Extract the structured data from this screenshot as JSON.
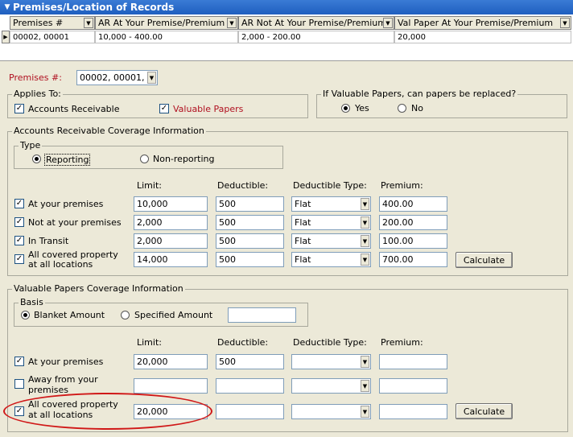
{
  "title": "Premises/Location of Records",
  "grid": {
    "columns": [
      "Premises #",
      "AR At Your Premise/Premium",
      "AR Not At Your Premise/Premium",
      "Val Paper At Your Premise/Premium"
    ],
    "rows": [
      [
        "00002, 00001",
        "10,000 - 400.00",
        "2,000 - 200.00",
        "20,000"
      ]
    ]
  },
  "premises": {
    "label": "Premises #:",
    "value": "00002, 00001,"
  },
  "applies_to": {
    "legend": "Applies To:",
    "accounts_receivable": "Accounts Receivable",
    "valuable_papers": "Valuable Papers"
  },
  "replace": {
    "legend": "If Valuable Papers, can papers be replaced?",
    "yes": "Yes",
    "no": "No"
  },
  "ar": {
    "legend": "Accounts Receivable Coverage Information",
    "type_legend": "Type",
    "reporting": "Reporting",
    "non_reporting": "Non-reporting",
    "headers": {
      "limit": "Limit:",
      "deductible": "Deductible:",
      "deductible_type": "Deductible Type:",
      "premium": "Premium:"
    },
    "rows": [
      {
        "label": "At your premises",
        "limit": "10,000",
        "deductible": "500",
        "type": "Flat",
        "premium": "400.00"
      },
      {
        "label": "Not at your premises",
        "limit": "2,000",
        "deductible": "500",
        "type": "Flat",
        "premium": "200.00"
      },
      {
        "label": "In Transit",
        "limit": "2,000",
        "deductible": "500",
        "type": "Flat",
        "premium": "100.00"
      },
      {
        "label1": "All covered property",
        "label2": "at all locations",
        "limit": "14,000",
        "deductible": "500",
        "type": "Flat",
        "premium": "700.00"
      }
    ],
    "calculate": "Calculate"
  },
  "vp": {
    "legend": "Valuable Papers Coverage Information",
    "basis_legend": "Basis",
    "blanket": "Blanket Amount",
    "specified": "Specified Amount",
    "specified_value": "",
    "headers": {
      "limit": "Limit:",
      "deductible": "Deductible:",
      "deductible_type": "Deductible Type:",
      "premium": "Premium:"
    },
    "rows": [
      {
        "label": "At your premises",
        "limit": "20,000",
        "deductible": "500",
        "type": "",
        "premium": ""
      },
      {
        "label1": "Away from your",
        "label2": "premises",
        "limit": "",
        "deductible": "",
        "type": "",
        "premium": ""
      },
      {
        "label1": "All covered property",
        "label2": "at all locations",
        "limit": "20,000",
        "deductible": "",
        "type": "",
        "premium": ""
      }
    ],
    "calculate": "Calculate"
  },
  "colors": {
    "title_bar": "#1f5fbf",
    "label_red": "#b01020",
    "annotation": "#d01818"
  },
  "icons": {
    "collapse": "triangle-down-icon",
    "checkbox": "check-icon",
    "dropdown": "chevron-down-icon"
  }
}
